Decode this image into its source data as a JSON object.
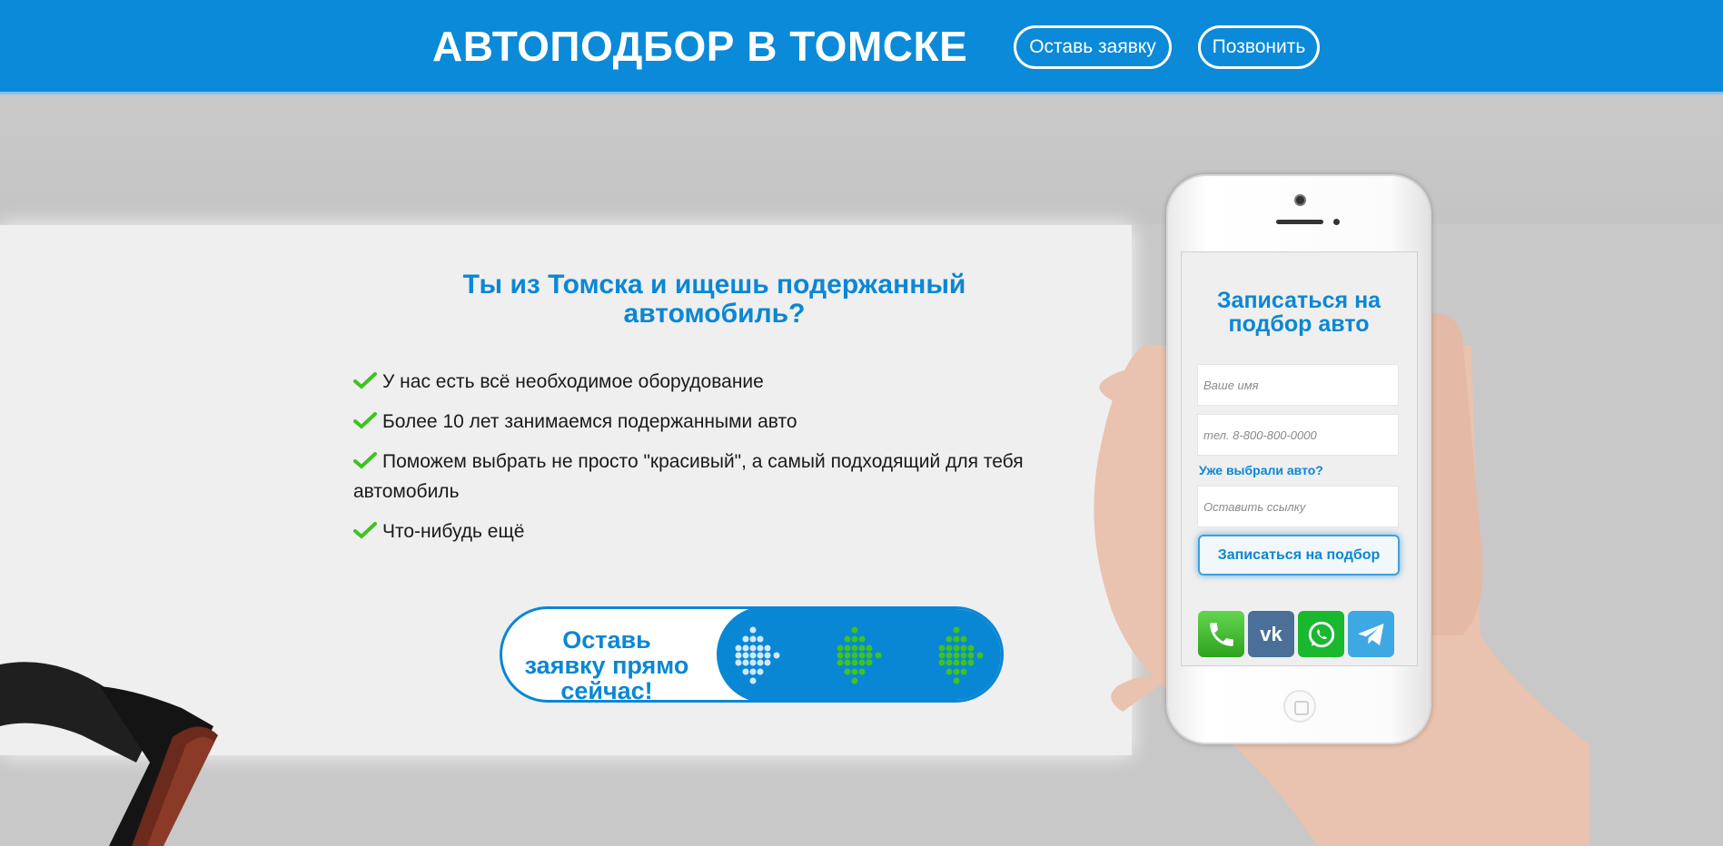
{
  "header": {
    "brand": "АВТОПОДБОР В ТОМСКЕ",
    "order_button": "Оставь заявку",
    "call_button": "Позвонить"
  },
  "main": {
    "headline": "Ты из Томска и ищешь подержанный автомобиль?",
    "features": [
      "У нас есть всё необходимое оборудование",
      "Более 10 лет занимаемся подержанными авто",
      "Поможем выбрать не просто \"красивый\", а самый подходящий для тебя автомобиль",
      "Что-нибудь ещё"
    ],
    "cta_text": "Оставь заявку прямо сейчас!"
  },
  "form": {
    "title": "Записаться на подбор авто",
    "name_placeholder": "Ваше имя",
    "phone_placeholder": "тел. 8-800-800-0000",
    "chosen_label": "Уже выбрали авто?",
    "link_placeholder": "Оставить ссылку",
    "submit_label": "Записаться на подбор",
    "socials": [
      "phone-icon",
      "vk-icon",
      "whatsapp-icon",
      "telegram-icon"
    ],
    "vk_label": "vk"
  },
  "colors": {
    "accent": "#0a87d4",
    "header_bg": "#0a8ad8",
    "check": "#3ec31f",
    "arrow_green": "#3ec31f"
  }
}
